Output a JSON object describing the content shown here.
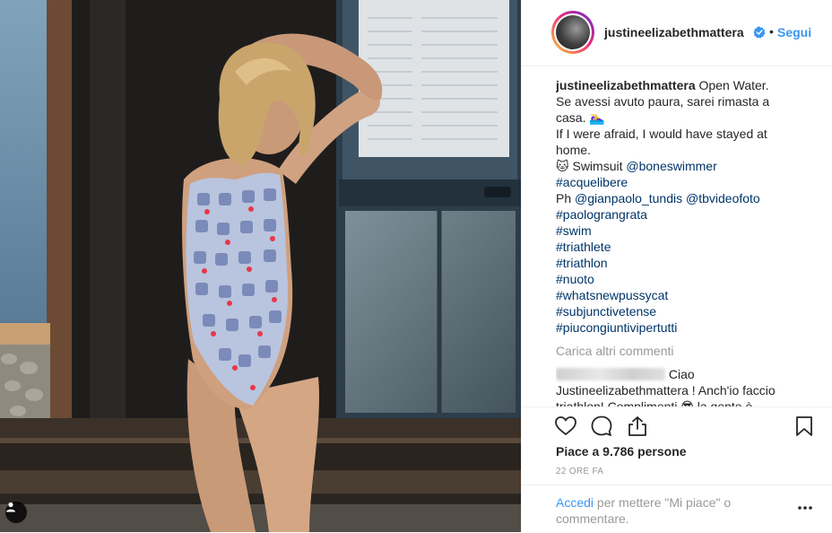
{
  "post": {
    "username": "justineelizabethmattera",
    "follow_label": "Segui",
    "dot": "•",
    "caption_lines": [
      "Open Water.",
      "Se avessi avuto paura, sarei rimasta a",
      "casa. 🏊‍♀️",
      "If I were afraid, I would have stayed at",
      "home.",
      "🐱 Swimsuit "
    ],
    "swimsuit_link": "@boneswimmer",
    "hashtag_acquelibere": "#acquelibere",
    "photo_prefix": "Ph ",
    "photo_link_1": "@gianpaolo_tundis",
    "photo_link_2": "@tbvideofoto",
    "hashtags": [
      "#paolograngrata",
      "#swim",
      "#triathlete",
      "#triathlon",
      "#nuoto",
      "#whatsnewpussycat",
      "#subjunctivetense",
      "#piucongiuntivipertutti"
    ],
    "load_more": "Carica altri commenti",
    "comment_text_1": "Ciao",
    "comment_text_2": "Justineelizabethmattera ! Anch'io faccio",
    "comment_text_3": "triathlon! Complimenti 😎 la gente è",
    "likes": "Piace a 9.786 persone",
    "time_ago": "22 ORE FA",
    "login_link": "Accedi",
    "login_rest": "per mettere \"Mi piace\" o commentare."
  },
  "icons": {
    "verified": "verified-badge-icon",
    "like": "heart-icon",
    "comment": "comment-bubble-icon",
    "share": "share-icon",
    "save": "bookmark-icon",
    "more": "more-options-icon",
    "tag": "user-tag-icon"
  },
  "colors": {
    "link_blue": "#3897f0",
    "hashtag": "#003569",
    "muted": "#999999",
    "text": "#262626",
    "border": "#efefef"
  }
}
